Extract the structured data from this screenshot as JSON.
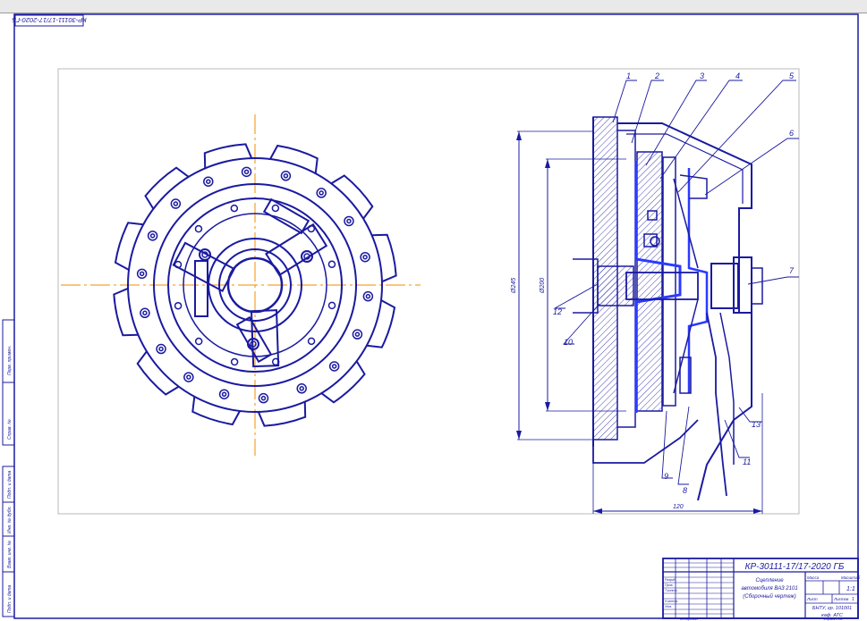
{
  "sheet": {
    "corner_stamp": "КР-30111-17/17-2020-ГБ",
    "title_block": {
      "designation": "КР-30111-17/17-2020 ГБ",
      "name_line1": "Сцепление",
      "name_line2": "автомобиля ВАЗ 2101",
      "name_line3": "(Сборочный чертеж)",
      "sheet_label": "Лист",
      "sheets_label": "Листов",
      "sheets_count": "1",
      "mass_label": "Масса",
      "scale_label": "Масштаб",
      "scale_value": "1:1",
      "org_line1": "БНТУ, гр. 101001",
      "org_line2": "каф. АТС",
      "copied_label": "Копировал",
      "format_label": "Формат A1",
      "role_labels": [
        "Изм.",
        "Лист",
        "№ докум.",
        "Подп.",
        "Дата",
        "Разраб.",
        "Пров.",
        "Т.контр.",
        "Н.контр.",
        "Утв."
      ]
    },
    "side_labels": [
      "Перв. примен.",
      "Справ. №",
      "Подп. и дата",
      "Инв. № дубл.",
      "Взам. инв. №",
      "Подп. и дата",
      "Инв. № подл."
    ]
  },
  "drawing": {
    "callouts": [
      "1",
      "2",
      "3",
      "4",
      "5",
      "6",
      "7",
      "8",
      "9",
      "10",
      "11",
      "12",
      "13"
    ],
    "dimensions": {
      "outer_diameter": "Ø245",
      "inner_diameter": "Ø200",
      "width": "120"
    }
  },
  "colors": {
    "line": "#1a1aa0",
    "center": "#f08c00",
    "frame": "#1a1aa0",
    "highlight": "#2b3bff"
  }
}
